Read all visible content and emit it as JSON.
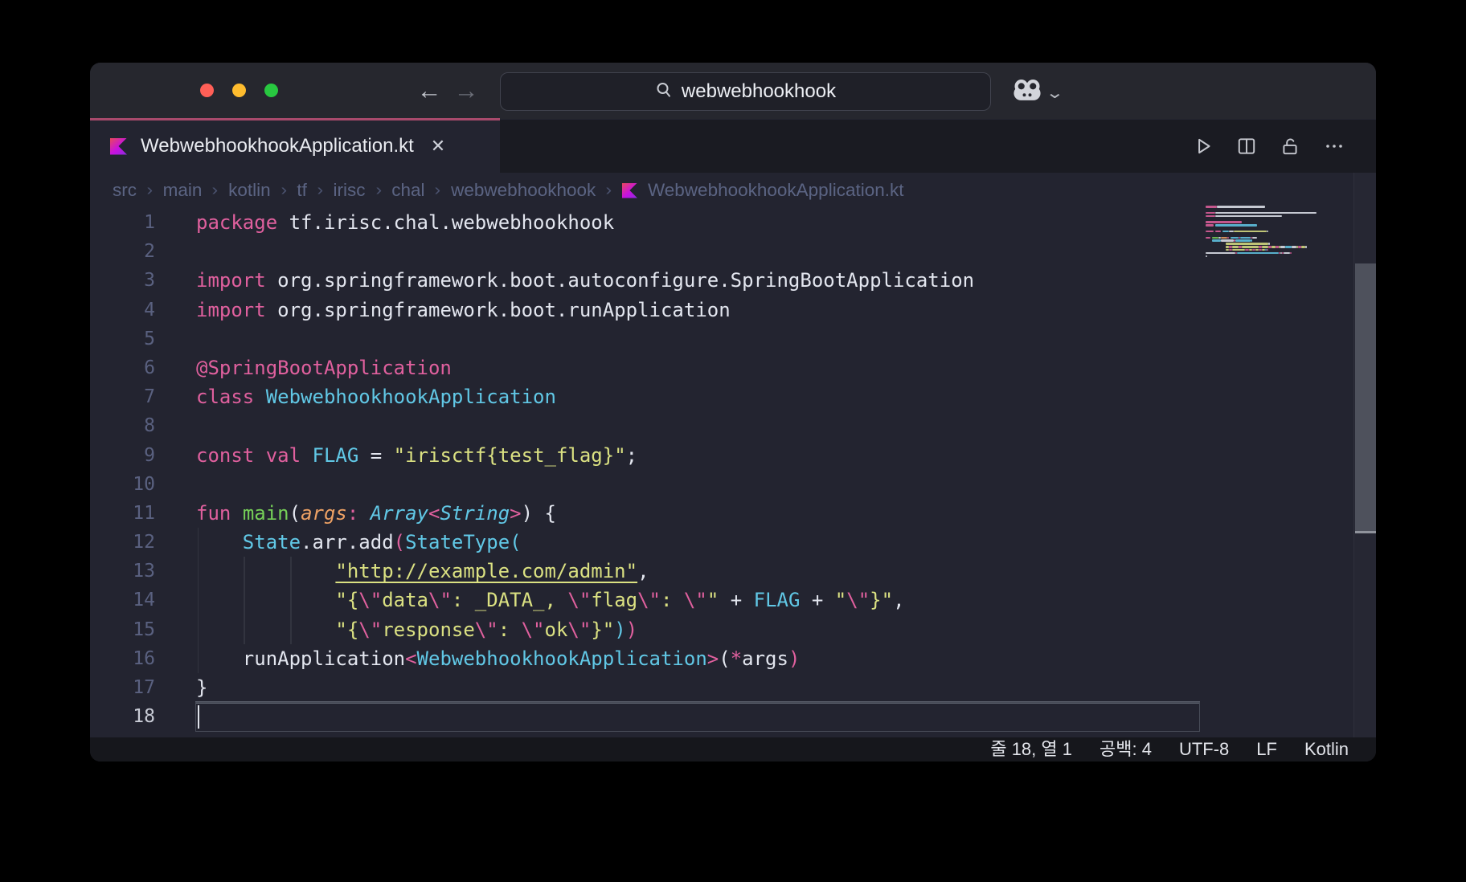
{
  "window": {
    "search_value": "webwebhookhook",
    "traffic_lights": [
      {
        "name": "close",
        "color": "#ff5f57"
      },
      {
        "name": "minimize",
        "color": "#febc2e"
      },
      {
        "name": "zoom",
        "color": "#28c840"
      }
    ],
    "nav": {
      "back_glyph": "←",
      "forward_glyph": "→"
    },
    "collab_menu_chevron": "⌄"
  },
  "tab": {
    "label": "WebwebhookhookApplication.kt",
    "close_glyph": "✕",
    "icon": "kotlin-logo-icon"
  },
  "toolbar_icons": [
    "play-icon",
    "split-pane-icon",
    "unlock-icon",
    "ellipsis-icon"
  ],
  "breadcrumb": {
    "separator": "›",
    "items": [
      {
        "label": "src"
      },
      {
        "label": "main"
      },
      {
        "label": "kotlin"
      },
      {
        "label": "tf"
      },
      {
        "label": "irisc"
      },
      {
        "label": "chal"
      },
      {
        "label": "webwebhookhook"
      },
      {
        "label": "WebwebhookhookApplication.kt",
        "icon": "kotlin-logo-icon"
      }
    ]
  },
  "editor": {
    "cursor": {
      "line": 18,
      "column": 1
    },
    "indent_guides": [
      {
        "col": 0,
        "from": 12,
        "to": 16
      },
      {
        "col": 4,
        "from": 13,
        "to": 15
      },
      {
        "col": 8,
        "from": 13,
        "to": 15
      }
    ],
    "lines": [
      {
        "n": 1,
        "tokens": [
          {
            "c": "pink",
            "t": "package"
          },
          {
            "c": "white",
            "t": " tf.irisc.chal.webwebhookhook"
          }
        ]
      },
      {
        "n": 2,
        "tokens": []
      },
      {
        "n": 3,
        "tokens": [
          {
            "c": "pink",
            "t": "import"
          },
          {
            "c": "white",
            "t": " org.springframework.boot.autoconfigure.SpringBootApplication"
          }
        ]
      },
      {
        "n": 4,
        "tokens": [
          {
            "c": "pink",
            "t": "import"
          },
          {
            "c": "white",
            "t": " org.springframework.boot.runApplication"
          }
        ]
      },
      {
        "n": 5,
        "tokens": []
      },
      {
        "n": 6,
        "tokens": [
          {
            "c": "pink",
            "t": "@SpringBootApplication"
          }
        ]
      },
      {
        "n": 7,
        "tokens": [
          {
            "c": "pink",
            "t": "class"
          },
          {
            "c": "white",
            "t": " "
          },
          {
            "c": "cyan",
            "t": "WebwebhookhookApplication"
          }
        ]
      },
      {
        "n": 8,
        "tokens": []
      },
      {
        "n": 9,
        "tokens": [
          {
            "c": "pink",
            "t": "const"
          },
          {
            "c": "white",
            "t": " "
          },
          {
            "c": "pink",
            "t": "val"
          },
          {
            "c": "white",
            "t": " "
          },
          {
            "c": "cyan",
            "t": "FLAG"
          },
          {
            "c": "white",
            "t": " = "
          },
          {
            "c": "yellow",
            "t": "\"irisctf{test_flag}\""
          },
          {
            "c": "white",
            "t": ";"
          }
        ]
      },
      {
        "n": 10,
        "tokens": []
      },
      {
        "n": 11,
        "tokens": [
          {
            "c": "pink",
            "t": "fun"
          },
          {
            "c": "white",
            "t": " "
          },
          {
            "c": "green",
            "t": "main"
          },
          {
            "c": "white",
            "t": "("
          },
          {
            "c": "orange_i",
            "t": "args"
          },
          {
            "c": "pink",
            "t": ":"
          },
          {
            "c": "white",
            "t": " "
          },
          {
            "c": "cyan_i",
            "t": "Array"
          },
          {
            "c": "pink",
            "t": "<"
          },
          {
            "c": "cyan_i",
            "t": "String"
          },
          {
            "c": "pink",
            "t": ">"
          },
          {
            "c": "white",
            "t": ") {"
          }
        ]
      },
      {
        "n": 12,
        "tokens": [
          {
            "c": "white",
            "t": "    "
          },
          {
            "c": "cyan",
            "t": "State"
          },
          {
            "c": "white",
            "t": ".arr.add"
          },
          {
            "c": "pink",
            "t": "("
          },
          {
            "c": "cyan",
            "t": "StateType"
          },
          {
            "c": "cyan",
            "t": "("
          }
        ]
      },
      {
        "n": 13,
        "tokens": [
          {
            "c": "white",
            "t": "            "
          },
          {
            "c": "yellow_u",
            "t": "\"http://example.com/admin\""
          },
          {
            "c": "white",
            "t": ","
          }
        ]
      },
      {
        "n": 14,
        "tokens": [
          {
            "c": "white",
            "t": "            "
          },
          {
            "c": "yellow",
            "t": "\"{"
          },
          {
            "c": "pink",
            "t": "\\\""
          },
          {
            "c": "yellow",
            "t": "data"
          },
          {
            "c": "pink",
            "t": "\\\""
          },
          {
            "c": "yellow",
            "t": ": _DATA_, "
          },
          {
            "c": "pink",
            "t": "\\\""
          },
          {
            "c": "yellow",
            "t": "flag"
          },
          {
            "c": "pink",
            "t": "\\\""
          },
          {
            "c": "yellow",
            "t": ": "
          },
          {
            "c": "pink",
            "t": "\\\""
          },
          {
            "c": "yellow",
            "t": "\""
          },
          {
            "c": "white",
            "t": " + "
          },
          {
            "c": "cyan",
            "t": "FLAG"
          },
          {
            "c": "white",
            "t": " + "
          },
          {
            "c": "yellow",
            "t": "\""
          },
          {
            "c": "pink",
            "t": "\\\""
          },
          {
            "c": "yellow",
            "t": "}\""
          },
          {
            "c": "white",
            "t": ","
          }
        ]
      },
      {
        "n": 15,
        "tokens": [
          {
            "c": "white",
            "t": "            "
          },
          {
            "c": "yellow",
            "t": "\"{"
          },
          {
            "c": "pink",
            "t": "\\\""
          },
          {
            "c": "yellow",
            "t": "response"
          },
          {
            "c": "pink",
            "t": "\\\""
          },
          {
            "c": "yellow",
            "t": ": "
          },
          {
            "c": "pink",
            "t": "\\\""
          },
          {
            "c": "yellow",
            "t": "ok"
          },
          {
            "c": "pink",
            "t": "\\\""
          },
          {
            "c": "yellow",
            "t": "}\""
          },
          {
            "c": "cyan",
            "t": ")"
          },
          {
            "c": "pink",
            "t": ")"
          }
        ]
      },
      {
        "n": 16,
        "tokens": [
          {
            "c": "white",
            "t": "    runApplication"
          },
          {
            "c": "pink",
            "t": "<"
          },
          {
            "c": "cyan",
            "t": "WebwebhookhookApplication"
          },
          {
            "c": "pink",
            "t": ">"
          },
          {
            "c": "white",
            "t": "("
          },
          {
            "c": "pink",
            "t": "*"
          },
          {
            "c": "white",
            "t": "args"
          },
          {
            "c": "pink",
            "t": ")"
          }
        ]
      },
      {
        "n": 17,
        "tokens": [
          {
            "c": "white",
            "t": "}"
          }
        ]
      },
      {
        "n": 18,
        "tokens": []
      }
    ]
  },
  "statusbar": {
    "items": [
      "줄 18, 열 1",
      "공백: 4",
      "UTF-8",
      "LF",
      "Kotlin"
    ]
  },
  "colors": {
    "accent_line": "#a84a6c",
    "titlebar_bg": "#26272e",
    "editor_bg": "#232430",
    "tabbar_bg": "#1a1b22",
    "statusbar_bg": "#16171c",
    "search_bg": "#1f2028",
    "pink": "#e0609e",
    "cyan": "#61c8e6",
    "green": "#76d058",
    "orange": "#eda164",
    "yellow": "#dbe182",
    "code_white": "#e3e6ef",
    "line_number": "#5a6180",
    "line_number_active": "#c9ccd6",
    "breadcrumb_text": "#5b6483",
    "kotlin_gradient": [
      "#e8485c",
      "#c711e1",
      "#8a2ee0"
    ]
  }
}
